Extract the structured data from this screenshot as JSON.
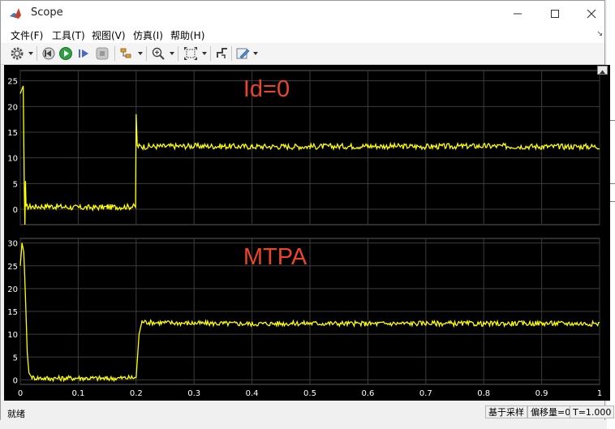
{
  "window": {
    "title": "Scope",
    "controls": [
      "minimize",
      "maximize",
      "close"
    ]
  },
  "menu": [
    {
      "label": "文件(F)"
    },
    {
      "label": "工具(T)"
    },
    {
      "label": "视图(V)"
    },
    {
      "label": "仿真(I)"
    },
    {
      "label": "帮助(H)"
    }
  ],
  "toolbar": {
    "icons": [
      "gear-icon",
      "step-back-icon",
      "run-icon",
      "step-forward-icon",
      "stop-icon",
      "highlight-icon",
      "zoom-icon",
      "autoscale-icon",
      "cursor-icon",
      "edit-icon"
    ]
  },
  "status": {
    "left": "就绪",
    "sample": "基于采样",
    "offset": "偏移量=0",
    "time": "T=1.000"
  },
  "colors": {
    "trace": "#ffff00",
    "annotation": "#e8452c",
    "plot_background": "#000000",
    "axis_text": "#ffffff"
  },
  "chart_data": [
    {
      "type": "line",
      "annotation": "Id=0",
      "xlim": [
        0,
        1
      ],
      "ylim": [
        -3,
        27
      ],
      "yticks": [
        0,
        5,
        10,
        15,
        20,
        25
      ],
      "grid": true,
      "series": [
        {
          "x": [
            0,
            0.005,
            0.007,
            0.008,
            0.009,
            0.01,
            0.02,
            0.05,
            0.1,
            0.15,
            0.19,
            0.199,
            0.2,
            0.202,
            0.21,
            0.3,
            0.4,
            0.5,
            0.6,
            0.7,
            0.8,
            0.9,
            1.0
          ],
          "y": [
            22.5,
            24,
            3.5,
            -3,
            5.5,
            0.5,
            0.5,
            0.6,
            0.3,
            0.4,
            0.5,
            0.5,
            18.5,
            12.3,
            12.2,
            12.3,
            12.2,
            12.2,
            12.3,
            12.2,
            12.3,
            12.2,
            12.2
          ]
        }
      ]
    },
    {
      "type": "line",
      "annotation": "MTPA",
      "xlim": [
        0,
        1
      ],
      "ylim": [
        -1,
        31
      ],
      "yticks": [
        0,
        5,
        10,
        15,
        20,
        25,
        30
      ],
      "xticks": [
        0,
        0.1,
        0.2,
        0.3,
        0.4,
        0.5,
        0.6,
        0.7,
        0.8,
        0.9,
        1
      ],
      "grid": true,
      "series": [
        {
          "x": [
            0,
            0.003,
            0.006,
            0.009,
            0.012,
            0.015,
            0.02,
            0.05,
            0.1,
            0.15,
            0.199,
            0.2,
            0.205,
            0.21,
            0.22,
            0.3,
            0.4,
            0.5,
            0.6,
            0.7,
            0.8,
            0.9,
            1.0
          ],
          "y": [
            25,
            30,
            28,
            18,
            6,
            1.5,
            0.5,
            0.3,
            0.4,
            0.3,
            0.5,
            0.5,
            10,
            12.8,
            12.6,
            12.4,
            12.3,
            12.4,
            12.3,
            12.4,
            12.3,
            12.4,
            12.3
          ]
        }
      ]
    }
  ]
}
